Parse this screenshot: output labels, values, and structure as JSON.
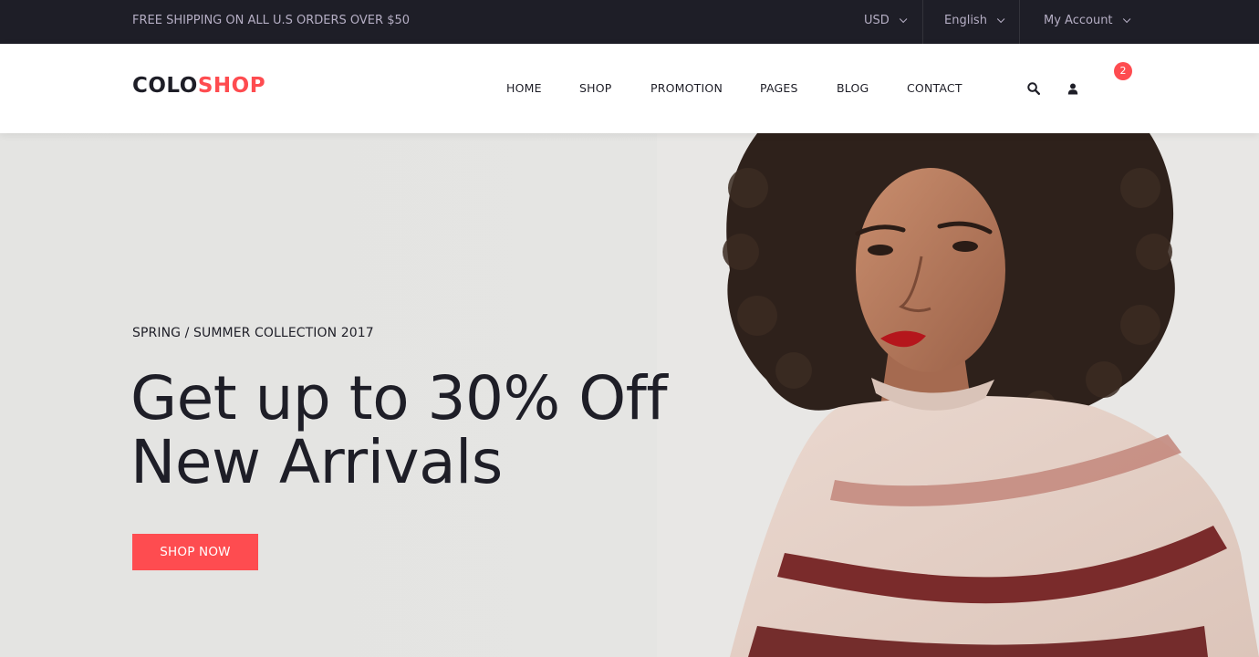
{
  "topbar": {
    "shipping_text": "FREE SHIPPING ON ALL U.S ORDERS OVER $50",
    "currency": "USD",
    "language": "English",
    "account": "My Account"
  },
  "header": {
    "logo_part1": "COLO",
    "logo_part2": "SHOP",
    "nav": [
      "HOME",
      "SHOP",
      "PROMOTION",
      "PAGES",
      "BLOG",
      "CONTACT"
    ],
    "icons": [
      "search-icon",
      "user-icon",
      "cart-icon"
    ],
    "cart_count": "2"
  },
  "hero": {
    "subtitle": "SPRING / SUMMER COLLECTION 2017",
    "title_line1": "Get up to 30% Off",
    "title_line2": "New Arrivals",
    "button": "SHOP NOW"
  },
  "colors": {
    "topbar_bg": "#1e1e27",
    "accent": "#fe4c50",
    "text_dark": "#1e1e27",
    "hero_bg": "#e5e5e3"
  }
}
